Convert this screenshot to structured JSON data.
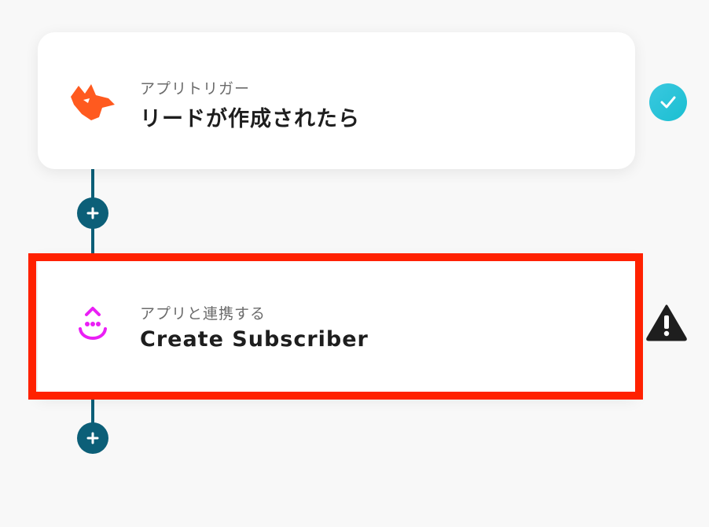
{
  "flow": {
    "trigger": {
      "type_label": "アプリトリガー",
      "title": "リードが作成されたら",
      "icon": "fox-icon",
      "icon_color": "#ff5a1f",
      "status": "completed",
      "status_icon": "check-circle-icon"
    },
    "action": {
      "type_label": "アプリと連携する",
      "title": "Create Subscriber",
      "icon": "drip-icon",
      "icon_color": "#ea1ff5",
      "status": "warning",
      "status_icon": "warning-icon",
      "highlighted": true
    },
    "add_step_icon": "plus-icon"
  },
  "colors": {
    "connector": "#0c5f78",
    "highlight": "#ff2100",
    "success": "#24c3d6",
    "warning": "#1e1e1e"
  }
}
